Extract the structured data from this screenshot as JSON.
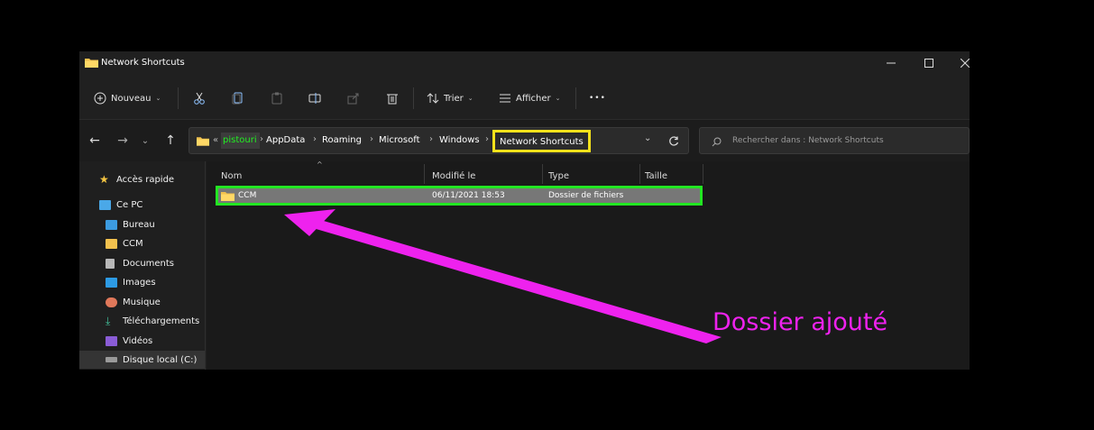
{
  "window": {
    "title": "Network Shortcuts",
    "minimize_icon": "minimize-icon",
    "maximize_icon": "maximize-icon",
    "close_icon": "close-icon"
  },
  "toolbar": {
    "new_label": "Nouveau",
    "sort_label": "Trier",
    "view_label": "Afficher",
    "more_label": "•••"
  },
  "address": {
    "overflow": "«",
    "user_segment": "pistouri",
    "segments": [
      "AppData",
      "Roaming",
      "Microsoft",
      "Windows",
      "Network Shortcuts"
    ],
    "refresh_icon": "refresh-icon"
  },
  "search": {
    "placeholder": "Rechercher dans : Network Shortcuts"
  },
  "sidebar": {
    "items": [
      {
        "label": "Accès rapide",
        "icon": "star-icon"
      },
      {
        "label": "Ce PC",
        "icon": "computer-icon"
      },
      {
        "label": "Bureau",
        "icon": "desktop-icon"
      },
      {
        "label": "CCM",
        "icon": "folder-icon"
      },
      {
        "label": "Documents",
        "icon": "documents-icon"
      },
      {
        "label": "Images",
        "icon": "images-icon"
      },
      {
        "label": "Musique",
        "icon": "music-icon"
      },
      {
        "label": "Téléchargements",
        "icon": "download-icon"
      },
      {
        "label": "Vidéos",
        "icon": "videos-icon"
      },
      {
        "label": "Disque local (C:)",
        "icon": "drive-icon"
      }
    ]
  },
  "columns": {
    "name": "Nom",
    "modified": "Modifié le",
    "type": "Type",
    "size": "Taille"
  },
  "files": [
    {
      "name": "CCM",
      "modified": "06/11/2021 18:53",
      "type": "Dossier de fichiers",
      "size": ""
    }
  ],
  "annotation": {
    "text": "Dossier ajouté"
  },
  "colors": {
    "highlight_path": "#f5e21b",
    "highlight_row": "#22e622",
    "annotation": "#ee22ee"
  }
}
